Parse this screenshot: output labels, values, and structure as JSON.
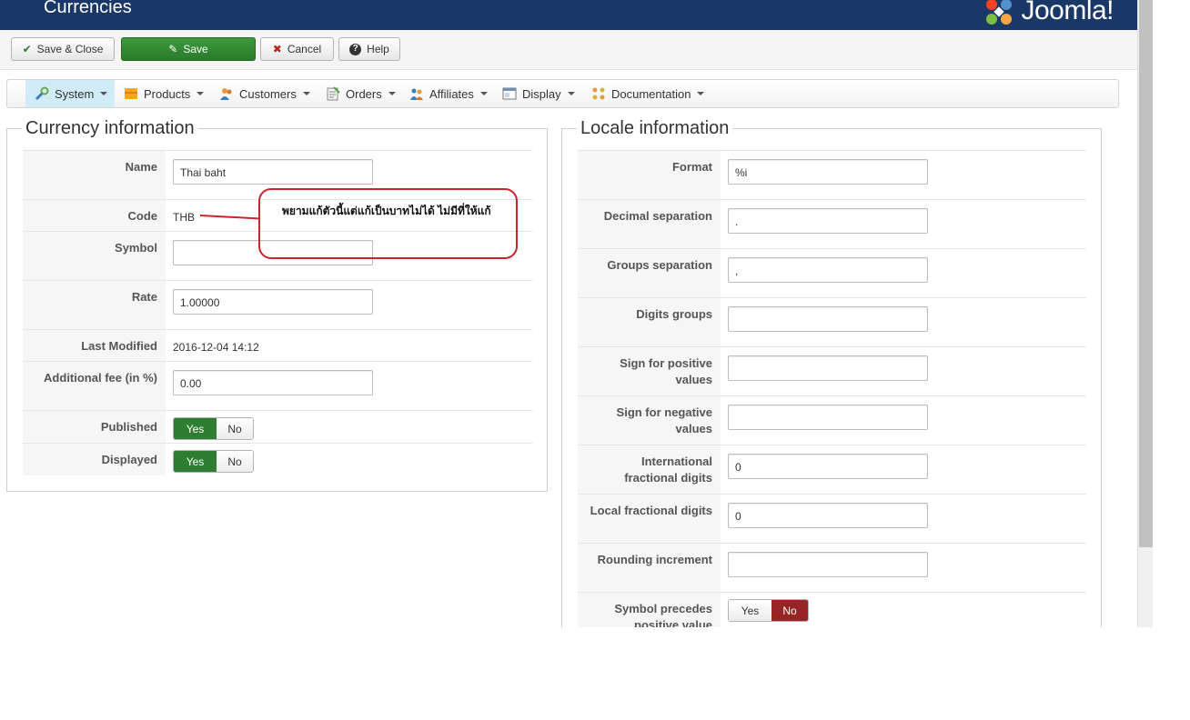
{
  "header": {
    "title": "Currencies",
    "logo_text": "Joomla!"
  },
  "toolbar": {
    "save_close": "Save & Close",
    "save": "Save",
    "cancel": "Cancel",
    "help": "Help"
  },
  "menu": {
    "items": [
      {
        "label": "System",
        "icon": "tools-icon",
        "active": true
      },
      {
        "label": "Products",
        "icon": "box-icon"
      },
      {
        "label": "Customers",
        "icon": "users-icon"
      },
      {
        "label": "Orders",
        "icon": "orders-icon"
      },
      {
        "label": "Affiliates",
        "icon": "affiliates-icon"
      },
      {
        "label": "Display",
        "icon": "display-icon"
      },
      {
        "label": "Documentation",
        "icon": "documentation-icon"
      }
    ]
  },
  "currency": {
    "legend": "Currency information",
    "name_label": "Name",
    "name_value": "Thai baht",
    "code_label": "Code",
    "code_value": "THB",
    "symbol_label": "Symbol",
    "symbol_value": "",
    "rate_label": "Rate",
    "rate_value": "1.00000",
    "modified_label": "Last Modified",
    "modified_value": "2016-12-04 14:12",
    "fee_label": "Additional fee (in %)",
    "fee_value": "0.00",
    "published_label": "Published",
    "displayed_label": "Displayed",
    "yes": "Yes",
    "no": "No",
    "published": "Yes",
    "displayed": "Yes"
  },
  "locale": {
    "legend": "Locale information",
    "format_label": "Format",
    "format_value": "%i",
    "decimal_label": "Decimal separation",
    "decimal_value": ".",
    "groups_label": "Groups separation",
    "groups_value": ",",
    "digits_label": "Digits groups",
    "digits_value": "",
    "positive_label": "Sign for positive values",
    "positive_value": "",
    "negative_label": "Sign for negative values",
    "negative_value": "",
    "intl_label": "International fractional digits",
    "intl_value": "0",
    "local_label": "Local fractional digits",
    "local_value": "0",
    "rounding_label": "Rounding increment",
    "rounding_value": "",
    "precedes_label": "Symbol precedes positive value",
    "yes": "Yes",
    "no": "No",
    "precedes": "No"
  },
  "annotation": {
    "text": "พยามแก้ตัวนี้แต่แก้เป็นบาทไม่ได้ ไม่มีที่ให้แก้"
  },
  "colors": {
    "header_bg": "#1a3867",
    "green": "#2f7d32",
    "red": "#982425",
    "callout": "#c8252c"
  }
}
